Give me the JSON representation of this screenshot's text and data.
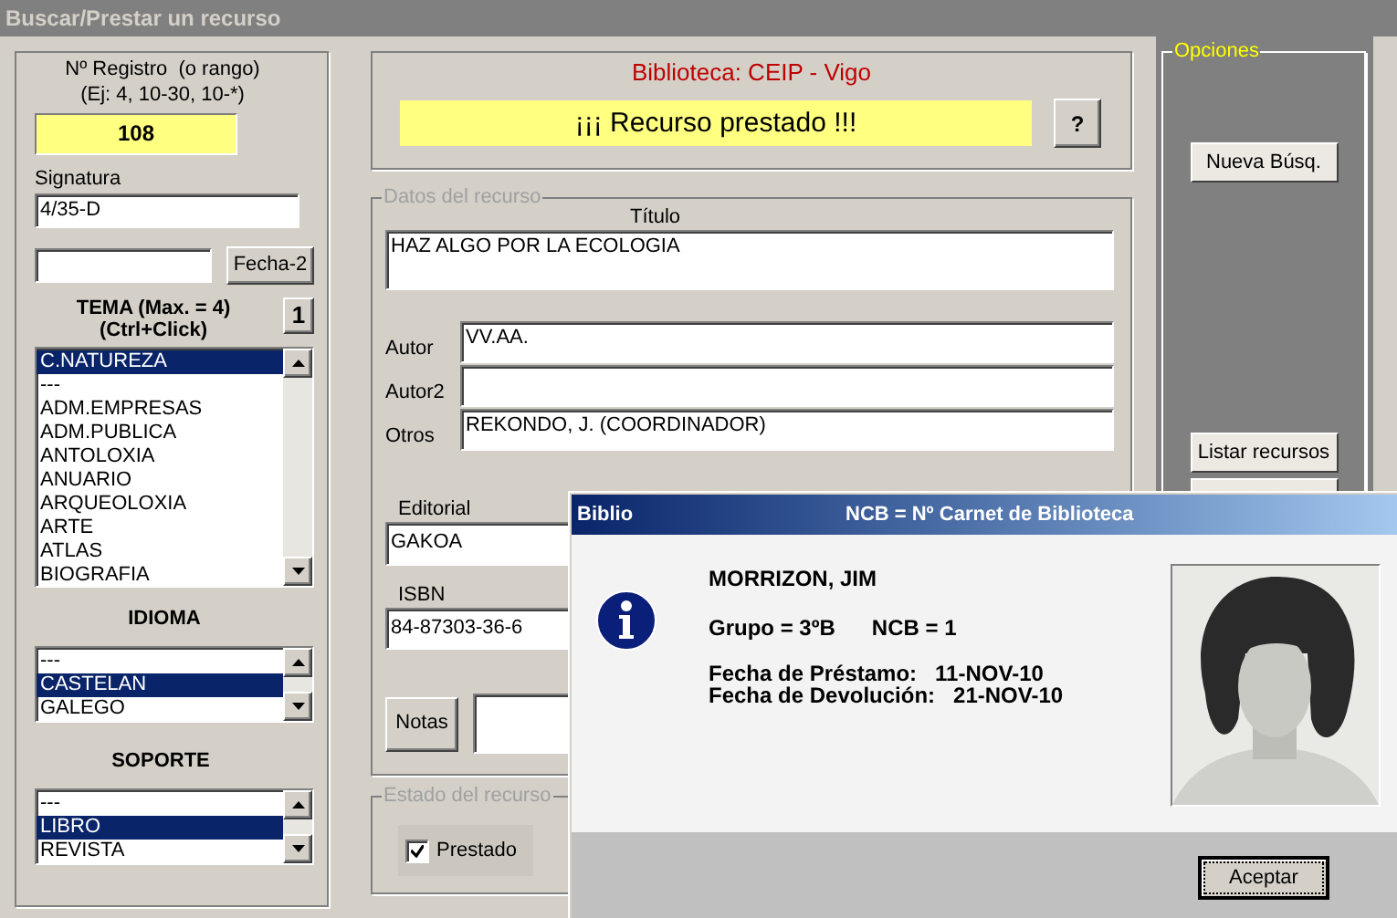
{
  "window": {
    "title": "Buscar/Prestar un recurso"
  },
  "search_panel": {
    "registro_label": "Nº Registro  (o rango)",
    "registro_hint": "(Ej: 4, 10-30, 10-*)",
    "registro_value": "108",
    "signatura_label": "Signatura",
    "signatura_value": "4/35-D",
    "fecha_button": "Fecha-2",
    "tema_label": "TEMA (Max. = 4)",
    "tema_hint": "(Ctrl+Click)",
    "tema_count_button": "1",
    "tema_items": [
      {
        "label": "C.NATUREZA",
        "selected": true
      },
      {
        "label": "---",
        "selected": false
      },
      {
        "label": "ADM.EMPRESAS",
        "selected": false
      },
      {
        "label": "ADM.PUBLICA",
        "selected": false
      },
      {
        "label": "ANTOLOXIA",
        "selected": false
      },
      {
        "label": "ANUARIO",
        "selected": false
      },
      {
        "label": "ARQUEOLOXIA",
        "selected": false
      },
      {
        "label": "ARTE",
        "selected": false
      },
      {
        "label": "ATLAS",
        "selected": false
      },
      {
        "label": "BIOGRAFIA",
        "selected": false
      }
    ],
    "idioma_label": "IDIOMA",
    "idioma_items": [
      {
        "label": "---",
        "selected": false
      },
      {
        "label": "CASTELAN",
        "selected": true
      },
      {
        "label": "GALEGO",
        "selected": false
      }
    ],
    "soporte_label": "SOPORTE",
    "soporte_items": [
      {
        "label": "---",
        "selected": false
      },
      {
        "label": "LIBRO",
        "selected": true
      },
      {
        "label": "REVISTA",
        "selected": false
      }
    ]
  },
  "library": "Biblioteca: CEIP - Vigo",
  "status_message": "¡¡¡ Recurso prestado !!!",
  "help_button": "?",
  "resource": {
    "legend": "Datos del recurso",
    "title_label": "Título",
    "title": "HAZ ALGO POR LA ECOLOGIA",
    "fields": [
      {
        "label": "Autor",
        "value": "VV.AA."
      },
      {
        "label": "Autor2"
      },
      {
        "label": "Otros",
        "value": "REKONDO, J. (COORDINADOR)"
      }
    ],
    "editorial_label": "Editorial",
    "editorial": "GAKOA",
    "isbn_label": "ISBN",
    "isbn": "84-87303-36-6",
    "notes_button": "Notas"
  },
  "state": {
    "legend": "Estado del recurso",
    "checkbox": {
      "label": "Prestado",
      "checked": true
    }
  },
  "options": {
    "legend": "Opciones",
    "buttons": [
      "Nueva Búsq.",
      "Listar recursos"
    ]
  },
  "dialog": {
    "app": "Biblio",
    "title": "NCB = Nº Carnet de Biblioteca",
    "name": "MORRIZON, JIM",
    "group": "Grupo = 3ºB",
    "ncb": "NCB = 1",
    "loan_label": "Fecha de Préstamo:",
    "loan_date": "11-NOV-10",
    "return_label": "Fecha de Devolución:",
    "return_date": "21-NOV-10",
    "ok_button": "Aceptar"
  }
}
